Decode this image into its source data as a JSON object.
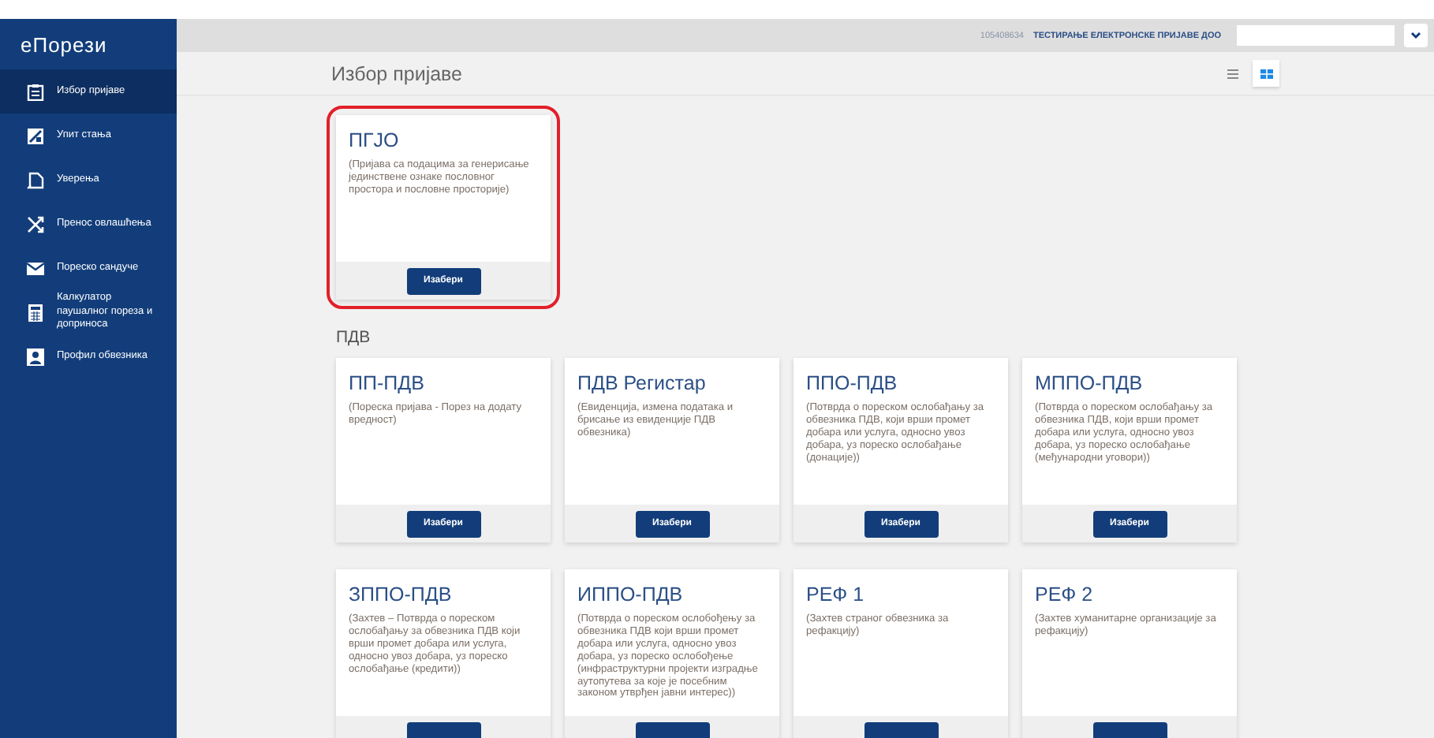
{
  "sidebar": {
    "logo": "еПорези",
    "items": [
      {
        "label": "Избор пријаве",
        "selected": true
      },
      {
        "label": "Упит стања",
        "selected": false
      },
      {
        "label": "Уверења",
        "selected": false
      },
      {
        "label": "Пренос овлашћења",
        "selected": false
      },
      {
        "label": "Пореско сандуче",
        "selected": false
      },
      {
        "label": "Калкулатор паушалног пореза и доприноса",
        "selected": false
      },
      {
        "label": "Профил обвезника",
        "selected": false
      }
    ]
  },
  "top_bar": {
    "taxpayer_id": "105408634",
    "company": "ТЕСТИРАЊЕ ЕЛЕКТРОНСКЕ ПРИЈАВЕ ДОО"
  },
  "page_title": "Избор пријаве",
  "view_toggle": [
    {
      "kind": "list",
      "selected": false
    },
    {
      "kind": "grid",
      "selected": true
    }
  ],
  "sections": [
    {
      "cards": [
        {
          "title": "ПГЈО",
          "description": "(Пријава са подацима за генерисање јединствене ознаке пословног простора и пословне просторије)",
          "button": "Изабери",
          "highlighted": true
        }
      ]
    },
    {
      "heading": "ПДВ",
      "cards": [
        {
          "title": "ПП-ПДВ",
          "description": "(Пореска пријава - Порез на додату вредност)",
          "button": "Изабери"
        },
        {
          "title": "ПДВ Регистар",
          "description": "(Евиденција, измена података и брисање из евиденције ПДВ обвезника)",
          "button": "Изабери"
        },
        {
          "title": "ППО-ПДВ",
          "description": "(Потврда о пореском ослобађању за обвезника ПДВ, који врши промет добара или услуга, односно увоз добара, уз пореско ослобађање (донације))",
          "button": "Изабери"
        },
        {
          "title": "МППО-ПДВ",
          "description": "(Потврда о пореском ослобађању за обвезника ПДВ, који врши промет добара или услуга, односно увоз добара, уз пореско ослобађање (међународни уговори))",
          "button": "Изабери"
        },
        {
          "title": "ЗППО-ПДВ",
          "description": "(Захтев – Потврда о пореском ослобађању за обвезника ПДВ који врши промет добара или услуга, односно увоз добара, уз пореско ослобађање (кредити))",
          "button": true
        },
        {
          "title": "ИППО-ПДВ",
          "description": "(Потврда о пореском ослобођењу за обвезника ПДВ који врши промет добара или услуга, односно увоз добара, уз пореско ослобођење (инфраструктурни пројекти изградње аутопутева за које је посебним законом утврђен јавни интерес))",
          "button": true
        },
        {
          "title": "РЕФ 1",
          "description": "(Захтев страног обвезника за рефакцију)",
          "button": true
        },
        {
          "title": "РЕФ 2",
          "description": "(Захтев хуманитарне организације за рефакцију)",
          "button": true
        }
      ]
    }
  ]
}
